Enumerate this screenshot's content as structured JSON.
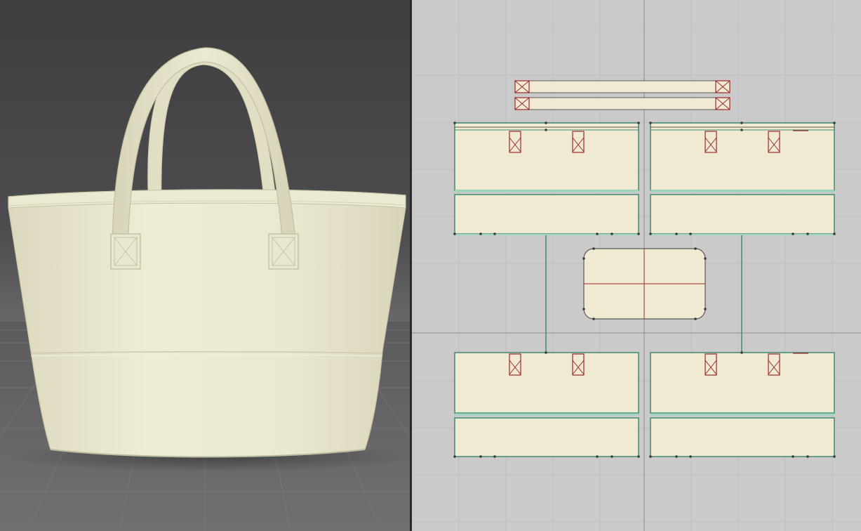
{
  "app": {
    "panels": [
      {
        "id": "avatar-3d-view",
        "kind": "3D garment simulation view"
      },
      {
        "id": "pattern-2d-view",
        "kind": "2D pattern editor"
      }
    ]
  },
  "colors": {
    "viewport_3d_bg": "#4a4a4c",
    "floor": "#6e6e70",
    "fabric": "#ece9d2",
    "fabric_shadow": "#cfcbb0",
    "viewport_2d_bg": "#cacaca",
    "grid_line": "#b9b9b9",
    "axis_line": "#8f8f8f",
    "pattern_fill": "#f1ead3",
    "seam_line": "#3e8a6e",
    "seam_highlight": "#9fd6c0",
    "internal_line": "#9b2a2a"
  },
  "scene_3d": {
    "object": "tote-bag-icon",
    "handle_count": 2
  },
  "pattern_2d": {
    "pieces": [
      {
        "name": "handle-strap"
      },
      {
        "name": "handle-strap"
      },
      {
        "name": "front-upper-panel"
      },
      {
        "name": "back-upper-panel"
      },
      {
        "name": "front-lower-panel"
      },
      {
        "name": "back-lower-panel"
      },
      {
        "name": "bottom-panel"
      },
      {
        "name": "front-upper-panel"
      },
      {
        "name": "back-upper-panel"
      },
      {
        "name": "front-lower-panel"
      },
      {
        "name": "back-lower-panel"
      }
    ]
  }
}
